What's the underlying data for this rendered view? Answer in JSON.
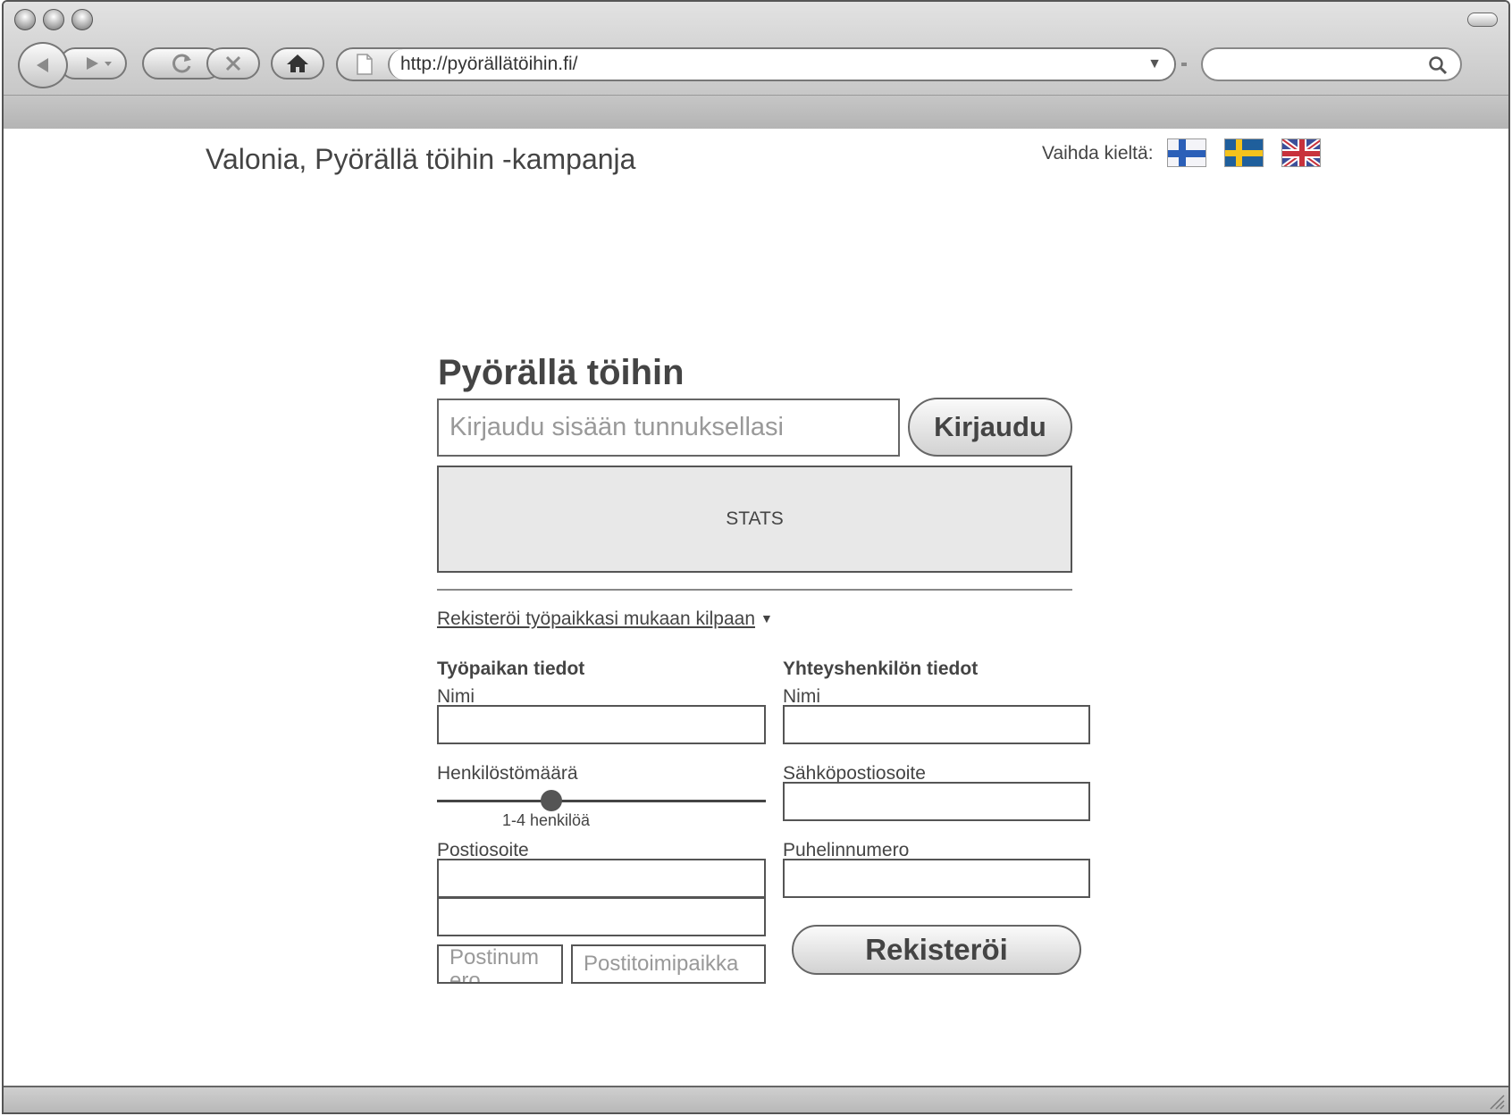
{
  "browser": {
    "url": "http://pyörällätöihin.fi/",
    "search_placeholder": "",
    "icons": [
      "back-arrow-icon",
      "forward-arrow-icon",
      "reload-icon",
      "stop-icon",
      "home-icon",
      "page-icon",
      "dropdown-icon",
      "search-icon"
    ]
  },
  "header": {
    "site_title": "Valonia, Pyörällä töihin -kampanja",
    "language_label": "Vaihda kieltä:",
    "languages": [
      "finnish-flag",
      "swedish-flag",
      "uk-flag"
    ]
  },
  "login": {
    "heading": "Pyörällä töihin",
    "input_placeholder": "Kirjaudu sisään tunnuksellasi",
    "button_label": "Kirjaudu"
  },
  "stats": {
    "label": "STATS"
  },
  "registration": {
    "toggle_label": "Rekisteröi työpaikkasi mukaan kilpaan",
    "workplace": {
      "title": "Työpaikan tiedot",
      "name_label": "Nimi",
      "staff_label": "Henkilöstömäärä",
      "staff_value": "1-4 henkilöä",
      "staff_slider_fraction": 0.35,
      "address_label": "Postiosoite",
      "postcode_placeholder": "Postinum ero",
      "city_placeholder": "Postitoimipaikka"
    },
    "contact": {
      "title": "Yhteyshenkilön tiedot",
      "name_label": "Nimi",
      "email_label": "Sähköpostiosoite",
      "phone_label": "Puhelinnumero"
    },
    "submit_label": "Rekisteröi"
  },
  "colors": {
    "chrome_gray": "#c9c9c9",
    "stats_fill": "#e8e8e8",
    "text": "#444444"
  }
}
